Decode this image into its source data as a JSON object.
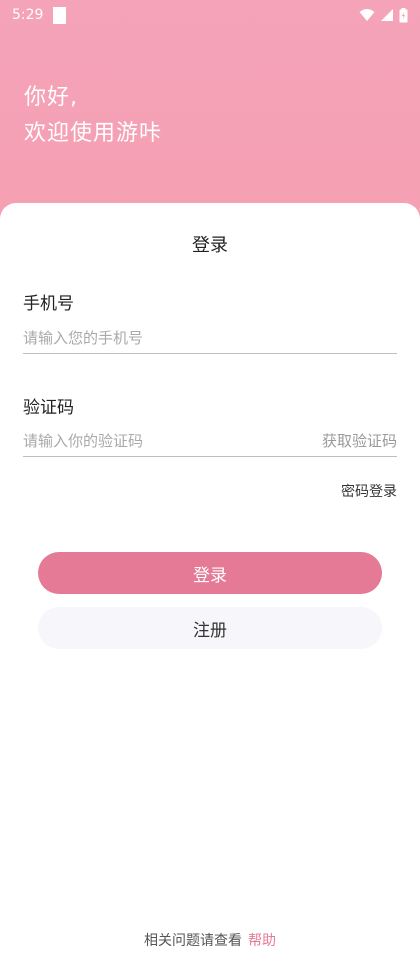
{
  "status_bar": {
    "time": "5:29",
    "icons": [
      "notification-icon",
      "wifi-icon",
      "signal-icon",
      "battery-icon"
    ]
  },
  "greeting": {
    "line1": "你好,",
    "line2": "欢迎使用游咔"
  },
  "login": {
    "title": "登录",
    "phone_label": "手机号",
    "phone_placeholder": "请输入您的手机号",
    "code_label": "验证码",
    "code_placeholder": "请输入你的验证码",
    "get_code": "获取验证码",
    "password_login": "密码登录",
    "login_button": "登录",
    "register_button": "注册"
  },
  "help": {
    "text": "相关问题请查看",
    "link": "帮助"
  },
  "colors": {
    "accent": "#e57a96",
    "header_gradient_top": "#f4a3b9",
    "header_gradient_bottom": "#fb9c9f",
    "register_bg": "#f6f6fb"
  }
}
